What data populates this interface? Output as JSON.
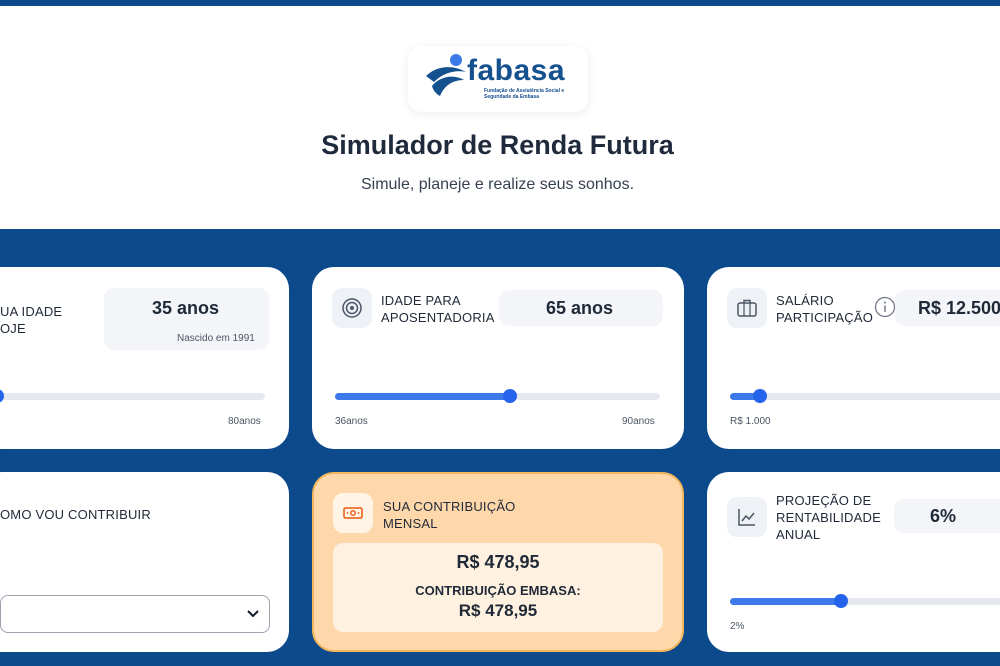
{
  "header": {
    "logo_text": "fabasa",
    "logo_tagline": "Fundação de Assistência Social e Seguridade da Embasa",
    "title": "Simulador de Renda Futura",
    "subtitle": "Simule, planeje e realize seus sonhos."
  },
  "cards": {
    "current_age": {
      "label": "UA IDADE\nOJE",
      "value": "35 anos",
      "note": "Nascido em 1991",
      "max_label": "80anos",
      "slider_fraction": 0.06
    },
    "retirement_age": {
      "label": "IDADE PARA\nAPOSENTADORIA",
      "value": "65 anos",
      "min_label": "36anos",
      "max_label": "90anos",
      "slider_fraction": 0.537,
      "icon": "target-icon"
    },
    "salary": {
      "label": "SALÁRIO\nPARTICIPAÇÃO",
      "value": "R$ 12.500",
      "min_label": "R$ 1.000",
      "slider_fraction": 0.1,
      "icon": "briefcase-icon",
      "info_icon": "info-icon"
    },
    "contribution_mode": {
      "label": "OMO VOU CONTRIBUIR",
      "select_value": ""
    },
    "monthly_contribution": {
      "label": "SUA CONTRIBUIÇÃO\nMENSAL",
      "value": "R$ 478,95",
      "embasa_label": "CONTRIBUIÇÃO EMBASA:",
      "embasa_value": "R$ 478,95",
      "icon": "money-icon"
    },
    "return_projection": {
      "label": "PROJEÇÃO DE\nRENTABILIDADE\nANUAL",
      "value": "6%",
      "min_label": "2%",
      "slider_fraction": 0.37,
      "icon": "chart-line-icon"
    }
  },
  "colors": {
    "brand_blue": "#0c4a8c",
    "slider_blue": "#2563eb",
    "contribution_bg": "#fed7aa"
  }
}
